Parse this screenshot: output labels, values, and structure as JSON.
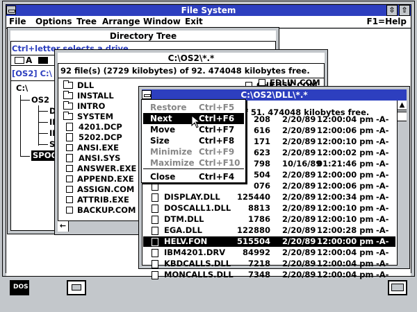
{
  "main": {
    "title": "File System",
    "menu": [
      "File",
      "Options",
      "Tree",
      "Arrange",
      "Window",
      "Exit"
    ],
    "help": "F1=Help",
    "restore_glyph": "⇳",
    "max_glyph": "⇧"
  },
  "dir_tree": {
    "title": "Directory Tree",
    "hint": "Ctrl+letter selects a drive.",
    "drive_a": "A",
    "path": "[OS2]  C:\\",
    "items": [
      "C:\\",
      "OS2",
      "DL",
      "IN",
      "IN",
      "SY",
      "SPOO"
    ]
  },
  "os2_win": {
    "title": "C:\\OS2\\*.*",
    "status": "92 file(s) (2729 kilobytes) of 92.  474048 kilobytes free.",
    "left": [
      {
        "type": "folder",
        "name": "DLL"
      },
      {
        "type": "folder",
        "name": "INSTALL"
      },
      {
        "type": "folder",
        "name": "INTRO"
      },
      {
        "type": "folder",
        "name": "SYSTEM"
      },
      {
        "type": "file",
        "name": "4201.DCP"
      },
      {
        "type": "file",
        "name": "5202.DCP"
      },
      {
        "type": "file",
        "name": "ANSI.EXE"
      },
      {
        "type": "file",
        "name": "ANSI.SYS"
      },
      {
        "type": "file",
        "name": "ANSWER.EXE"
      },
      {
        "type": "file",
        "name": "APPEND.EXE"
      },
      {
        "type": "file",
        "name": "ASSIGN.COM"
      },
      {
        "type": "file",
        "name": "ATTRIB.EXE"
      },
      {
        "type": "file",
        "name": "BACKUP.COM"
      }
    ],
    "right": [
      "CHKDSK.COM",
      "EDLIN.COM"
    ]
  },
  "dll_win": {
    "title": "C:\\OS2\\DLL\\*.*",
    "status": "of 51.  474048 kilobytes free.",
    "files": [
      {
        "name": "",
        "size": "208",
        "date": "2/20/89",
        "time": "12:00:04 pm",
        "attr": "-A-"
      },
      {
        "name": "",
        "size": "616",
        "date": "2/20/89",
        "time": "12:00:06 pm",
        "attr": "-A-"
      },
      {
        "name": "",
        "size": "171",
        "date": "2/20/89",
        "time": "12:00:10 pm",
        "attr": "-A-"
      },
      {
        "name": "",
        "size": "623",
        "date": "2/20/89",
        "time": "12:00:02 pm",
        "attr": "-A-"
      },
      {
        "name": "",
        "size": "798",
        "date": "10/16/89",
        "time": "01:21:46 pm",
        "attr": "-A-"
      },
      {
        "name": "",
        "size": "504",
        "date": "2/20/89",
        "time": "12:00:00 pm",
        "attr": "-A-"
      },
      {
        "name": "",
        "size": "076",
        "date": "2/20/89",
        "time": "12:00:06 pm",
        "attr": "-A-"
      },
      {
        "name": "DISPLAY.DLL",
        "size": "125440",
        "date": "2/20/89",
        "time": "12:00:34 pm",
        "attr": "-A-"
      },
      {
        "name": "DOSCALL1.DLL",
        "size": "8813",
        "date": "2/20/89",
        "time": "12:00:10 pm",
        "attr": "-A-"
      },
      {
        "name": "DTM.DLL",
        "size": "1786",
        "date": "2/20/89",
        "time": "12:00:10 pm",
        "attr": "-A-"
      },
      {
        "name": "EGA.DLL",
        "size": "122880",
        "date": "2/20/89",
        "time": "12:00:28 pm",
        "attr": "-A-"
      },
      {
        "name": "HELV.FON",
        "size": "515504",
        "date": "2/20/89",
        "time": "12:00:00 pm",
        "attr": "-A-",
        "selected": true
      },
      {
        "name": "IBM4201.DRV",
        "size": "84992",
        "date": "2/20/89",
        "time": "12:00:04 pm",
        "attr": "-A-"
      },
      {
        "name": "KBDCALLS.DLL",
        "size": "7218",
        "date": "2/20/89",
        "time": "12:00:04 pm",
        "attr": "-A-"
      },
      {
        "name": "MONCALLS.DLL",
        "size": "7348",
        "date": "2/20/89",
        "time": "12:00:04 pm",
        "attr": "-A-"
      }
    ]
  },
  "sysmenu": {
    "items": [
      {
        "label": "Restore",
        "accel": "Ctrl+F5",
        "state": "disabled"
      },
      {
        "label": "Next",
        "accel": "Ctrl+F6",
        "state": "highlighted"
      },
      {
        "label": "Move",
        "accel": "Ctrl+F7",
        "state": "enabled"
      },
      {
        "label": "Size",
        "accel": "Ctrl+F8",
        "state": "enabled"
      },
      {
        "label": "Minimize",
        "accel": "Ctrl+F9",
        "state": "disabled"
      },
      {
        "label": "Maximize",
        "accel": "Ctrl+F10",
        "state": "disabled"
      },
      {
        "label": "Close",
        "accel": "Ctrl+F4",
        "state": "enabled"
      }
    ]
  },
  "taskbar": {
    "dos_label": "DOS"
  }
}
